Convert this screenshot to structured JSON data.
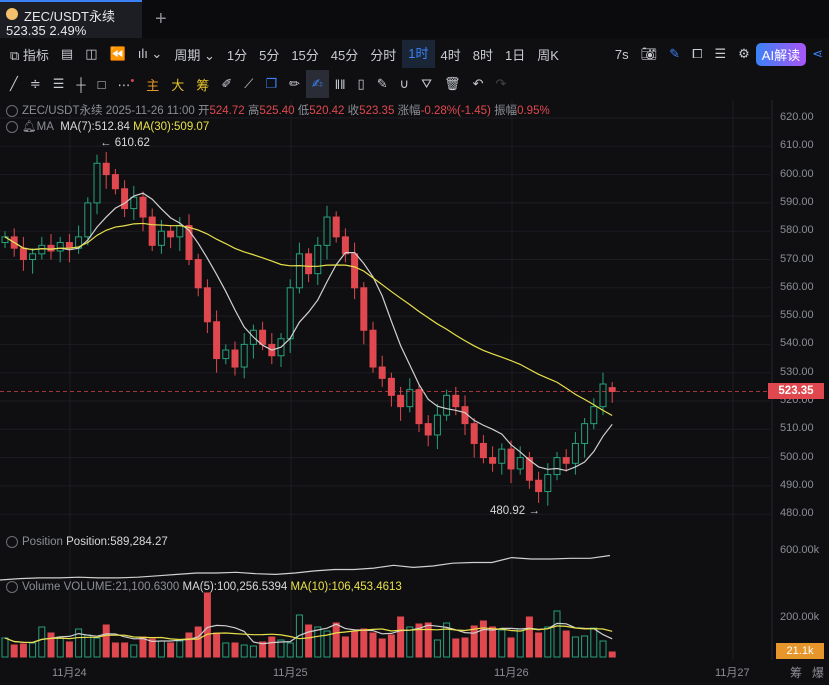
{
  "tab": {
    "symbol": "ZEC/USDT永续",
    "price": "523.35",
    "change": "2.49%",
    "add": "+"
  },
  "toolbar1": {
    "items": [
      "指标",
      "周期",
      "1分",
      "5分",
      "15分",
      "45分",
      "分时",
      "1时",
      "4时",
      "8时",
      "1日",
      "周K"
    ],
    "active": "1时",
    "refresh": "7s",
    "ai": "AI解读"
  },
  "toolbar2": {
    "items": [
      "主",
      "大",
      "筹"
    ]
  },
  "info": {
    "symbol": "ZEC/USDT永续",
    "time": "2025-11-26 11:00",
    "open_l": "开",
    "open": "524.72",
    "high_l": "高",
    "high": "525.40",
    "low_l": "低",
    "low": "520.42",
    "close_l": "收",
    "close": "523.35",
    "chg_l": "涨幅",
    "chg": "-0.28%(-1.45)",
    "amp_l": "振幅",
    "amp": "0.95%"
  },
  "ma": {
    "label": "MA",
    "ma7": "MA(7):512.84",
    "ma30": "MA(30):509.07"
  },
  "position": {
    "label": "Position",
    "value": "Position:589,284.27",
    "axis": "600.00k"
  },
  "volume": {
    "label": "Volume",
    "value": "VOLUME:21,100.6300",
    "ma5": "MA(5):100,256.5394",
    "ma10": "MA(10):106,453.4613",
    "axis": "200.00k",
    "last": "21.1k"
  },
  "annotations": {
    "high": "610.62",
    "low": "480.92"
  },
  "colors": {
    "up": "#26a17b",
    "down": "#e0484f",
    "ma7": "#d0d0d0",
    "ma30": "#e8e04a",
    "accent": "#3b82f6"
  },
  "footer": [
    "筹",
    "爆"
  ],
  "chart_data": {
    "type": "candlestick",
    "price_axis": [
      "620.00",
      "610.00",
      "600.00",
      "590.00",
      "580.00",
      "570.00",
      "560.00",
      "550.00",
      "540.00",
      "530.00",
      "520.00",
      "510.00",
      "500.00",
      "490.00",
      "480.00"
    ],
    "ylim": [
      478,
      622
    ],
    "x_labels": [
      "11月24",
      "11月25",
      "11月26",
      "11月27"
    ],
    "interval": "1h",
    "close": [
      578,
      574,
      570,
      572,
      575,
      573,
      576,
      574,
      578,
      590,
      604,
      600,
      595,
      588,
      592,
      585,
      575,
      580,
      578,
      582,
      570,
      560,
      548,
      535,
      538,
      532,
      540,
      545,
      540,
      536,
      542,
      560,
      572,
      565,
      575,
      585,
      578,
      572,
      560,
      545,
      532,
      528,
      522,
      518,
      524,
      512,
      508,
      515,
      522,
      518,
      512,
      505,
      500,
      498,
      503,
      496,
      500,
      492,
      488,
      494,
      500,
      498,
      505,
      512,
      518,
      526,
      523.35
    ],
    "last_open": 524.72,
    "volume": [
      95,
      60,
      65,
      70,
      150,
      120,
      100,
      75,
      140,
      110,
      95,
      160,
      70,
      70,
      60,
      100,
      90,
      80,
      70,
      80,
      120,
      150,
      320,
      120,
      70,
      70,
      60,
      55,
      75,
      100,
      85,
      70,
      210,
      160,
      150,
      130,
      170,
      100,
      130,
      140,
      120,
      90,
      110,
      200,
      150,
      165,
      170,
      85,
      170,
      90,
      95,
      155,
      180,
      150,
      135,
      95,
      140,
      200,
      120,
      150,
      230,
      130,
      100,
      105,
      145,
      80,
      25
    ],
    "position": [
      560,
      562,
      563,
      563,
      564,
      563,
      563,
      564,
      566,
      568,
      570,
      570,
      571,
      569,
      568,
      570,
      573,
      575,
      575,
      577,
      581,
      578,
      580,
      584,
      585,
      585,
      592,
      590,
      590,
      591,
      591,
      595
    ]
  }
}
